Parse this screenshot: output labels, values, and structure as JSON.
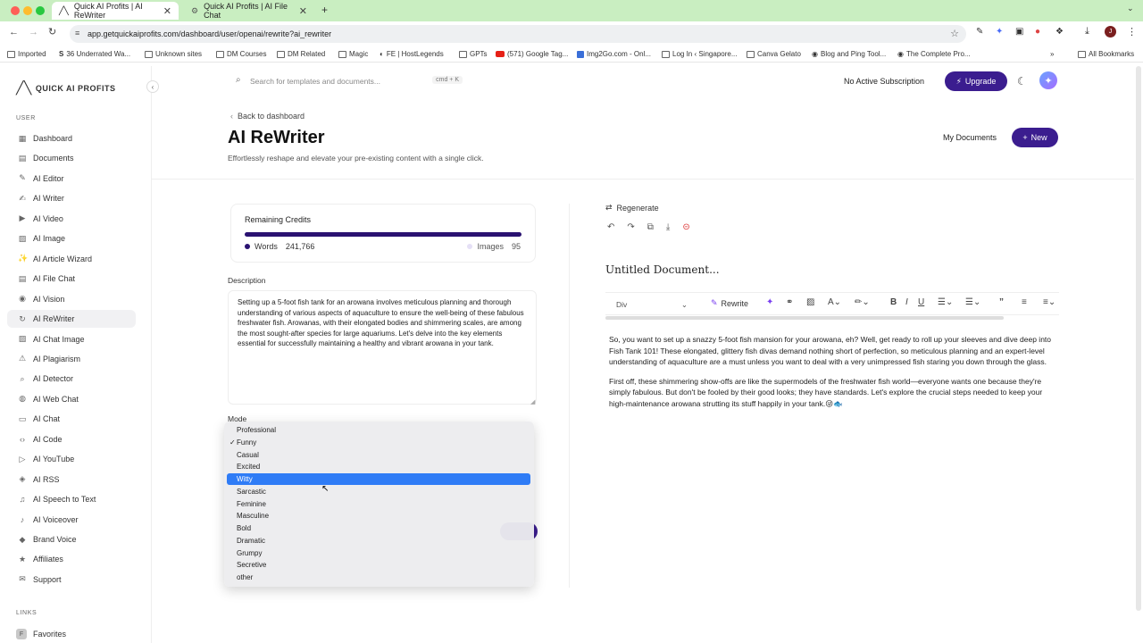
{
  "browser": {
    "tabs": [
      {
        "label": "Quick AI Profits | AI ReWriter",
        "active": true
      },
      {
        "label": "Quick AI Profits | AI File Chat",
        "active": false
      }
    ],
    "url": "app.getquickaiprofits.com/dashboard/user/openai/rewrite?ai_rewriter",
    "bookmarks": [
      "Imported",
      "36 Underrated Wa...",
      "Unknown sites",
      "DM Courses",
      "DM Related",
      "Magic",
      "FE | HostLegends",
      "GPTs",
      "(571) Google Tag...",
      "Img2Go.com - Onl...",
      "Log In ‹ Singapore...",
      "Canva Gelato",
      "Blog and Ping Tool...",
      "The Complete Pro...",
      "All Bookmarks"
    ]
  },
  "sidebar": {
    "logo_text": "QUICK AI PROFITS",
    "section_user": "USER",
    "items": [
      {
        "label": "Dashboard"
      },
      {
        "label": "Documents"
      },
      {
        "label": "AI Editor"
      },
      {
        "label": "AI Writer"
      },
      {
        "label": "AI Video"
      },
      {
        "label": "AI Image"
      },
      {
        "label": "AI Article Wizard"
      },
      {
        "label": "AI File Chat"
      },
      {
        "label": "AI Vision"
      },
      {
        "label": "AI ReWriter"
      },
      {
        "label": "AI Chat Image"
      },
      {
        "label": "AI Plagiarism"
      },
      {
        "label": "AI Detector"
      },
      {
        "label": "AI Web Chat"
      },
      {
        "label": "AI Chat"
      },
      {
        "label": "AI Code"
      },
      {
        "label": "AI YouTube"
      },
      {
        "label": "AI RSS"
      },
      {
        "label": "AI Speech to Text"
      },
      {
        "label": "AI Voiceover"
      },
      {
        "label": "Brand Voice"
      },
      {
        "label": "Affiliates"
      },
      {
        "label": "Support"
      }
    ],
    "active_item": "AI ReWriter",
    "section_links": "LINKS",
    "favorites": "Favorites"
  },
  "topbar": {
    "search_placeholder": "Search for templates and documents...",
    "shortcut": "cmd + K",
    "subscription": "No Active Subscription",
    "upgrade": "Upgrade"
  },
  "page": {
    "back": "Back to dashboard",
    "title": "AI ReWriter",
    "subtitle": "Effortlessly reshape and elevate your pre-existing content with a single click.",
    "my_documents": "My Documents",
    "new": "New"
  },
  "credits": {
    "label": "Remaining Credits",
    "words_label": "Words",
    "words": "241,766",
    "images_label": "Images",
    "images": "95",
    "words_fill_fraction": 1.0,
    "color_words": "#2a1271",
    "color_images": "#e5e0f6"
  },
  "form": {
    "description_label": "Description",
    "description": "Setting up a 5-foot fish tank for an arowana involves meticulous planning and thorough understanding of various aspects of aquaculture to ensure the well-being of these fabulous freshwater fish. Arowanas, with their elongated bodies and shimmering scales, are among the most sought-after species for large aquariums. Let's delve into the key elements essential for successfully maintaining a healthy and vibrant arowana in your tank.",
    "mode_label": "Mode",
    "mode_options": [
      "Professional",
      "Funny",
      "Casual",
      "Excited",
      "Witty",
      "Sarcastic",
      "Feminine",
      "Masculine",
      "Bold",
      "Dramatic",
      "Grumpy",
      "Secretive",
      "other"
    ],
    "checked_option": "Funny",
    "highlighted_option": "Witty"
  },
  "output": {
    "regenerate": "Regenerate",
    "doc_title": "Untitled Document...",
    "block_type": "Div",
    "rewrite": "Rewrite",
    "paragraphs": [
      "So, you want to set up a snazzy 5-foot fish mansion for your arowana, eh? Well, get ready to roll up your sleeves and dive deep into Fish Tank 101! These elongated, glittery fish divas demand nothing short of perfection, so meticulous planning and an expert-level understanding of aquaculture are a must unless you want to deal with a very unimpressed fish staring you down through the glass.",
      "First off, these shimmering show-offs are like the supermodels of the freshwater fish world—everyone wants one because they're simply fabulous. But don't be fooled by their good looks; they have standards. Let's explore the crucial steps needed to keep your high-maintenance arowana strutting its stuff happily in your tank.😜🐟"
    ]
  },
  "colors": {
    "accent": "#3b1d8f",
    "selection": "#2f7cf6",
    "tabbar": "#c9eec1"
  }
}
